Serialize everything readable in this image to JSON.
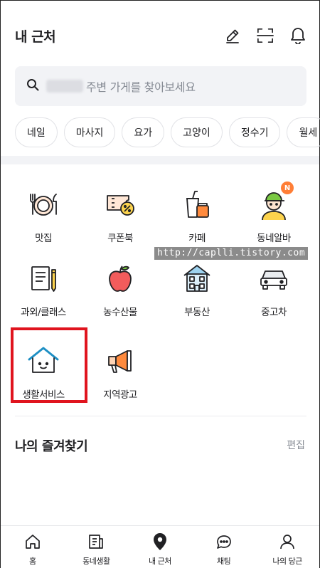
{
  "header": {
    "title": "내 근처",
    "icons": [
      "edit-icon",
      "scan-icon",
      "bell-icon"
    ]
  },
  "search": {
    "placeholder": "주변 가게를 찾아보세요"
  },
  "chips": [
    "네일",
    "마사지",
    "요가",
    "고양이",
    "정수기",
    "월세"
  ],
  "categories": [
    {
      "label": "맛집",
      "icon": "plate-icon"
    },
    {
      "label": "쿠폰북",
      "icon": "coupon-icon"
    },
    {
      "label": "카페",
      "icon": "cafe-icon"
    },
    {
      "label": "동네알바",
      "icon": "worker-icon",
      "badge": "N"
    },
    {
      "label": "과외/클래스",
      "icon": "notebook-icon"
    },
    {
      "label": "농수산물",
      "icon": "apple-icon"
    },
    {
      "label": "부동산",
      "icon": "building-icon"
    },
    {
      "label": "중고차",
      "icon": "car-icon"
    },
    {
      "label": "생활서비스",
      "icon": "house-icon"
    },
    {
      "label": "지역광고",
      "icon": "megaphone-icon"
    }
  ],
  "watermark": "http://caplli.tistory.com",
  "favorites": {
    "title": "나의 즐겨찾기",
    "edit_label": "편집"
  },
  "bottom_nav": [
    {
      "label": "홈",
      "icon": "home-icon"
    },
    {
      "label": "동네생활",
      "icon": "news-icon"
    },
    {
      "label": "내 근처",
      "icon": "location-pin-icon"
    },
    {
      "label": "채팅",
      "icon": "chat-icon"
    },
    {
      "label": "나의 당근",
      "icon": "person-icon"
    }
  ],
  "colors": {
    "accent": "#ff7e36",
    "highlight_box": "#e0141e",
    "search_bg": "#f2f3f6",
    "secondary_text": "#868b94"
  }
}
